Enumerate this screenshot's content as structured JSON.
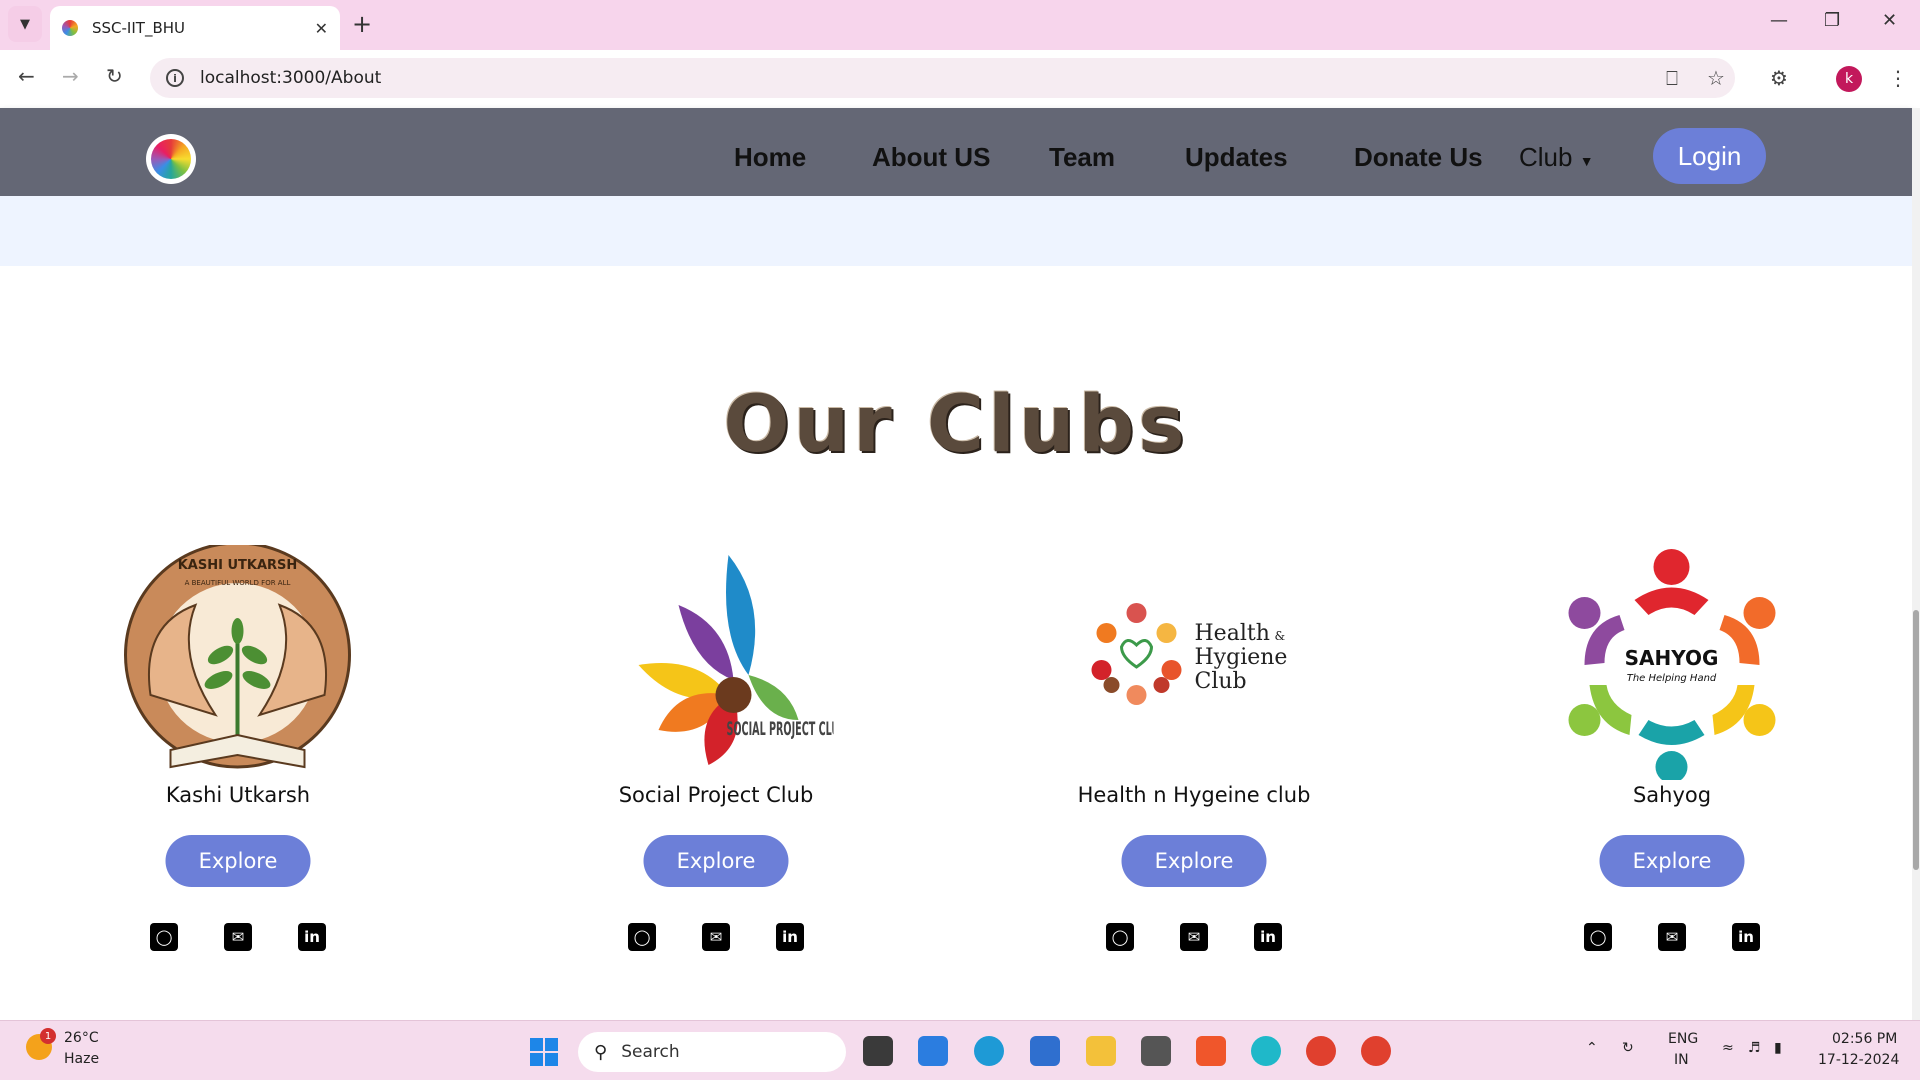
{
  "browser": {
    "tab_title": "SSC-IIT_BHU",
    "url": "localhost:3000/About",
    "profile_initial": "k"
  },
  "navbar": {
    "links": [
      "Home",
      "About US",
      "Team",
      "Updates",
      "Donate Us"
    ],
    "club_dropdown": "Club",
    "login": "Login"
  },
  "section": {
    "title": "Our Clubs"
  },
  "clubs": [
    {
      "name": "Kashi Utkarsh",
      "logo_text": "KASHI UTKARSH",
      "logo_subtext": "A BEAUTIFUL WORLD FOR ALL",
      "explore": "Explore"
    },
    {
      "name": "Social Project Club",
      "logo_text": "SOCIAL PROJECT CLUB",
      "explore": "Explore"
    },
    {
      "name": "Health n Hygeine club",
      "logo_text_1": "Health",
      "logo_text_amp": "&",
      "logo_text_2": "Hygiene",
      "logo_text_3": "Club",
      "explore": "Explore"
    },
    {
      "name": "Sahyog",
      "logo_text": "SAHYOG",
      "logo_subtext": "The Helping Hand",
      "explore": "Explore"
    }
  ],
  "taskbar": {
    "weather_temp": "26°C",
    "weather_cond": "Haze",
    "weather_badge": "1",
    "search_placeholder": "Search",
    "lang_1": "ENG",
    "lang_2": "IN",
    "time": "02:56 PM",
    "date": "17-12-2024"
  },
  "colors": {
    "navbar_bg": "#646775",
    "accent_button": "#6c7fd8",
    "tabbar_bg": "#f7d5ec"
  }
}
